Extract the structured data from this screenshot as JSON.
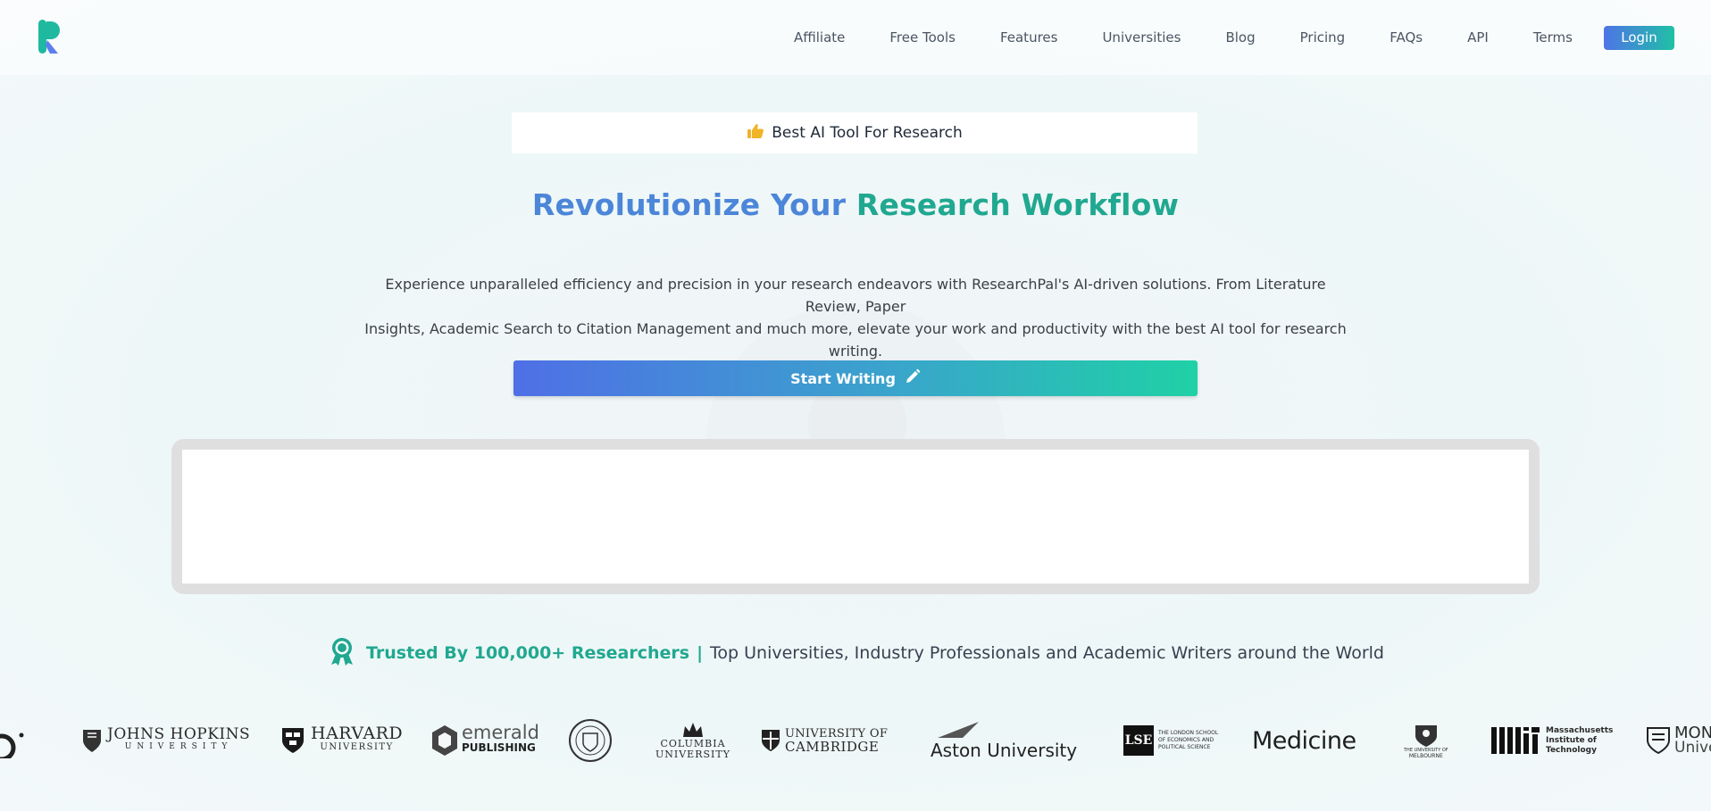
{
  "nav": {
    "items": [
      "Affiliate",
      "Free Tools",
      "Features",
      "Universities",
      "Blog",
      "Pricing",
      "FAQs",
      "API",
      "Terms"
    ],
    "login_label": "Login"
  },
  "badge": {
    "icon": "thumbs-up-icon",
    "label": "Best AI Tool For Research"
  },
  "hero": {
    "title_part1": "Revolutionize Your",
    "title_part2": "Research Workflow",
    "description_line1": "Experience unparalleled efficiency and precision in your research endeavors with ResearchPal's AI-driven solutions. From Literature Review, Paper",
    "description_line2": "Insights, Academic Search to Citation Management and much more, elevate your work and productivity with the best AI tool for research writing.",
    "cta_label": "Start Writing"
  },
  "trusted": {
    "icon": "award-ribbon-icon",
    "strong": "Trusted By 100,000+ Researchers",
    "separator": "|",
    "rest": "Top Universities, Industry Professionals and Academic Writers around the World"
  },
  "logos": {
    "jhu_line1": "JOHNS HOPKINS",
    "jhu_line2": "UNIVERSITY",
    "harvard_line1": "HARVARD",
    "harvard_line2": "UNIVERSITY",
    "emerald_line1": "emerald",
    "emerald_line2": "PUBLISHING",
    "columbia_line1": "COLUMBIA",
    "columbia_line2": "UNIVERSITY",
    "cambridge_line1": "UNIVERSITY OF",
    "cambridge_line2": "CAMBRIDGE",
    "aston": "Aston University",
    "lse_mark": "LSE",
    "lse_text1": "THE LONDON SCHOOL",
    "lse_text2": "OF ECONOMICS AND",
    "lse_text3": "POLITICAL SCIENCE",
    "medicine": "Medicine",
    "melbourne_line1": "THE UNIVERSITY OF",
    "melbourne_line2": "MELBOURNE",
    "mit_mark": "MIT",
    "mit_line1": "Massachusetts",
    "mit_line2": "Institute of",
    "mit_line3": "Technology",
    "monash_line1": "MONASH",
    "monash_line2": "University"
  },
  "colors": {
    "accent_blue": "#4c86d8",
    "accent_teal": "#20a890"
  }
}
